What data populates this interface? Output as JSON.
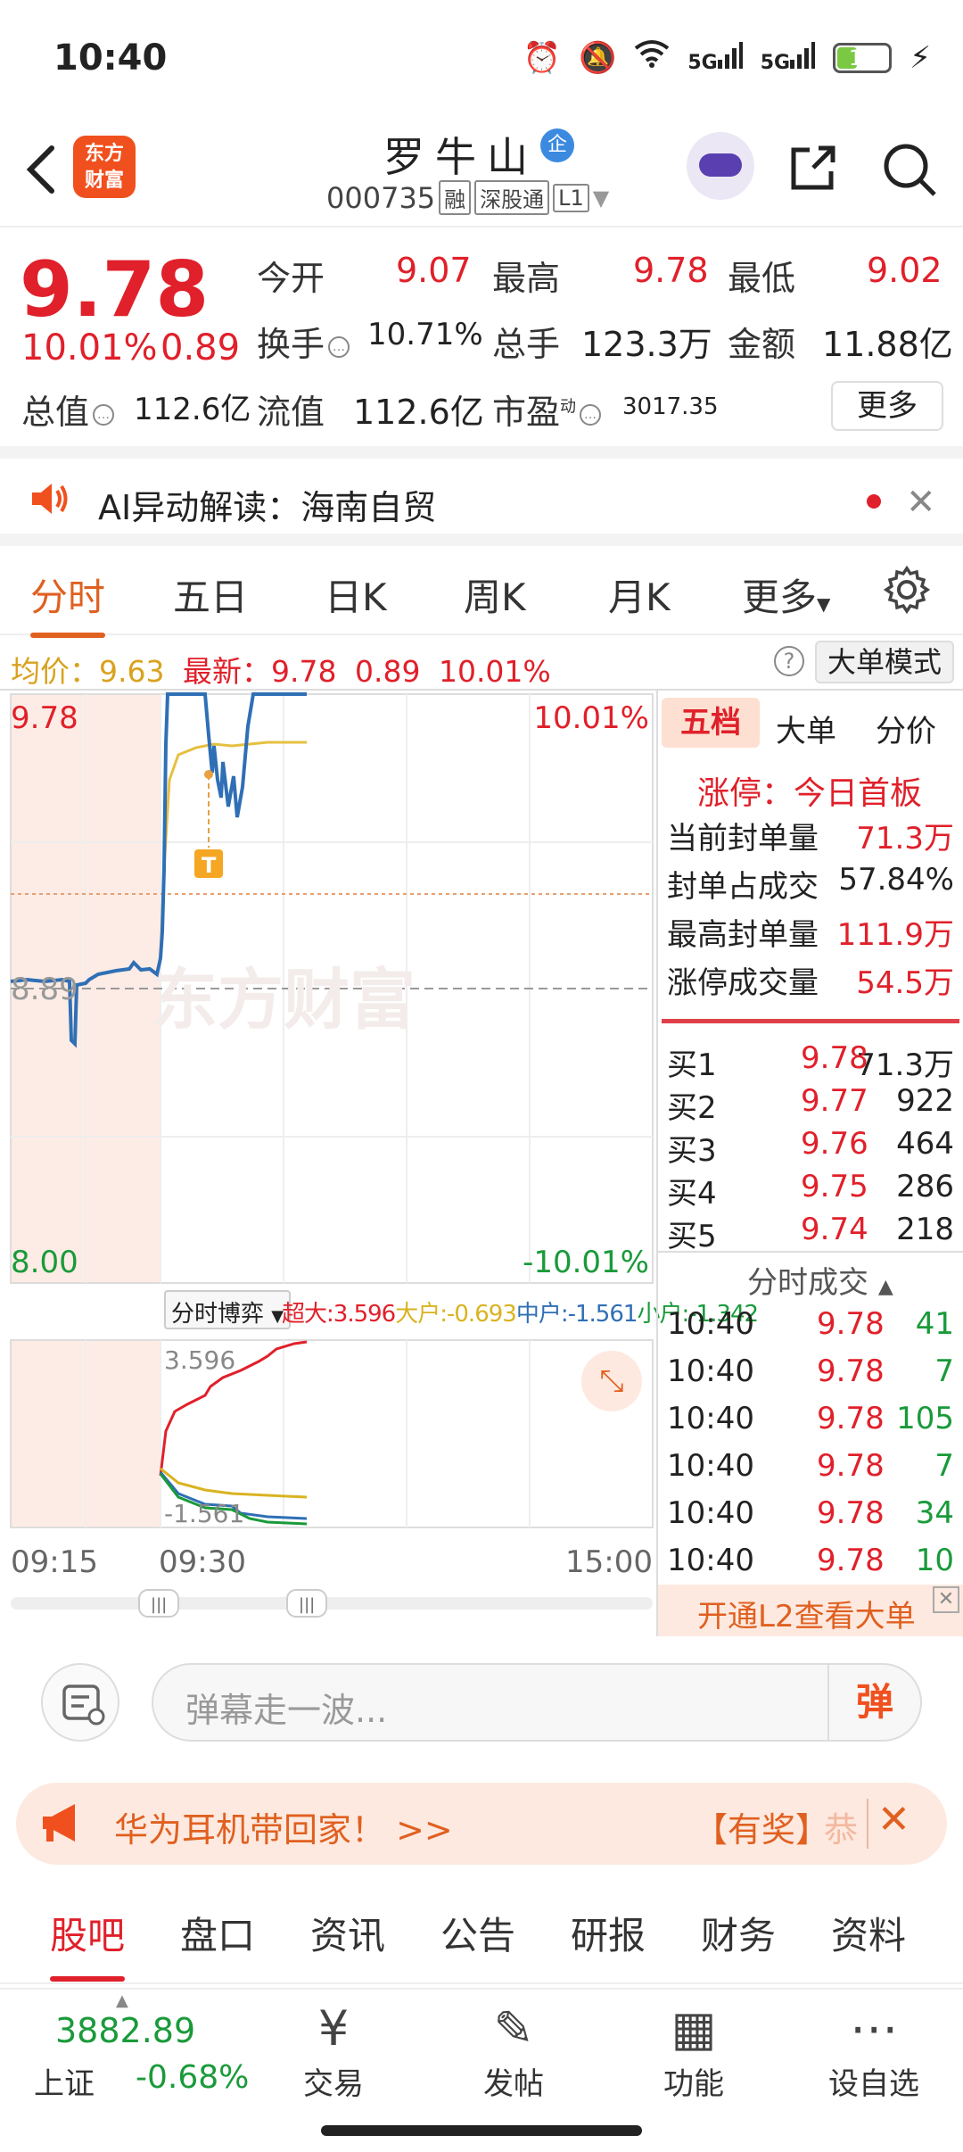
{
  "status": {
    "time": "10:40",
    "battery": "17",
    "alarm_icon": "alarm-icon",
    "mute_icon": "mute-icon",
    "wifi_icon": "wifi-icon",
    "signal1": "5G",
    "signal2": "5G"
  },
  "header": {
    "logo_line1": "东方",
    "logo_line2": "财富",
    "name": "罗牛山",
    "badge": "企",
    "code": "000735",
    "tags": [
      "融",
      "深股通",
      "L1"
    ]
  },
  "quote": {
    "price": "9.78",
    "pct": "10.01%",
    "chg": "0.89",
    "open_lbl": "今开",
    "open": "9.07",
    "high_lbl": "最高",
    "high": "9.78",
    "low_lbl": "最低",
    "low": "9.02",
    "turnover_lbl": "换手",
    "turnover": "10.71%",
    "vol_lbl": "总手",
    "vol": "123.3万",
    "amt_lbl": "金额",
    "amt": "11.88亿",
    "mcap_lbl": "总值",
    "mcap": "112.6亿",
    "float_lbl": "流值",
    "float": "112.6亿",
    "pe_lbl": "市盈",
    "pe_sup": "动",
    "pe": "3017.35",
    "more": "更多"
  },
  "ai": {
    "label": "AI异动解读：",
    "topic": "海南自贸"
  },
  "tabs": [
    "分时",
    "五日",
    "日K",
    "周K",
    "月K",
    "更多"
  ],
  "avgbar": {
    "avg_lbl": "均价：",
    "avg": "9.63",
    "last_lbl": "最新：",
    "last": "9.78",
    "chg": "0.89",
    "pct": "10.01%",
    "mode": "大单模式"
  },
  "chart": {
    "ymax": "9.78",
    "ymid": "8.89",
    "ymin": "8.00",
    "pmax": "10.01%",
    "pmin": "-10.01%",
    "watermark": "东方财富",
    "t_marker": "T",
    "x_start": "09:15",
    "x_mid": "09:30",
    "x_end": "15:00",
    "flow_selector": "分时博弈",
    "flow": [
      {
        "name": "超大",
        "value": "3.596",
        "color": "#e0202a"
      },
      {
        "name": "大户",
        "value": "-0.693",
        "color": "#d9b320"
      },
      {
        "name": "中户",
        "value": "-1.561",
        "color": "#2f6fb5"
      },
      {
        "name": "小户",
        "value": "-1.342",
        "color": "#1a9a3a"
      }
    ],
    "flow_top": "3.596",
    "flow_bottom": "-1.561"
  },
  "side": {
    "tabs": [
      "五档",
      "大单",
      "分价"
    ],
    "limit_title": "涨停：今日首板",
    "limit_rows": [
      {
        "k": "当前封单量",
        "v": "71.3万"
      },
      {
        "k": "封单占成交",
        "v": "57.84%"
      },
      {
        "k": "最高封单量",
        "v": "111.9万"
      },
      {
        "k": "涨停成交量",
        "v": "54.5万"
      }
    ],
    "bids": [
      {
        "k": "买1",
        "p": "9.78",
        "v": "71.3万"
      },
      {
        "k": "买2",
        "p": "9.77",
        "v": "922"
      },
      {
        "k": "买3",
        "p": "9.76",
        "v": "464"
      },
      {
        "k": "买4",
        "p": "9.75",
        "v": "286"
      },
      {
        "k": "买5",
        "p": "9.74",
        "v": "218"
      }
    ],
    "ticks_title": "分时成交",
    "ticks": [
      {
        "t": "10:40",
        "p": "9.78",
        "v": "41"
      },
      {
        "t": "10:40",
        "p": "9.78",
        "v": "7"
      },
      {
        "t": "10:40",
        "p": "9.78",
        "v": "105"
      },
      {
        "t": "10:40",
        "p": "9.78",
        "v": "7"
      },
      {
        "t": "10:40",
        "p": "9.78",
        "v": "34"
      },
      {
        "t": "10:40",
        "p": "9.78",
        "v": "10"
      }
    ],
    "l2": "开通L2查看大单"
  },
  "input": {
    "placeholder": "弹幕走一波...",
    "danmu": "弹"
  },
  "promo": {
    "text": "华为耳机带回家！ >>",
    "tag": "【有奖】",
    "tail": "恭"
  },
  "bottom_tabs": [
    "股吧",
    "盘口",
    "资讯",
    "公告",
    "研报",
    "财务",
    "资料"
  ],
  "nav": {
    "index_value": "3882.89",
    "index_name": "上证",
    "index_pct": "-0.68%",
    "items": [
      "交易",
      "发帖",
      "功能",
      "设自选"
    ]
  }
}
